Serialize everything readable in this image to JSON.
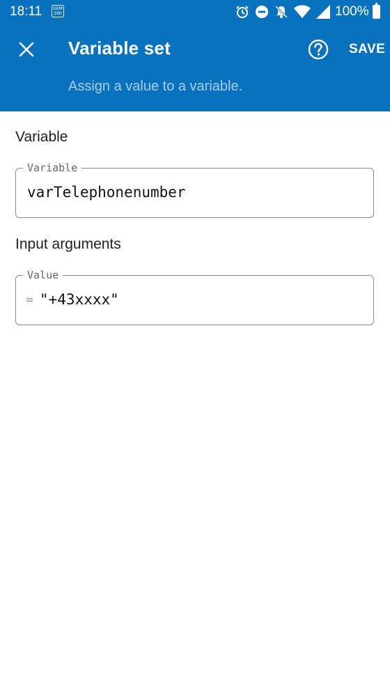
{
  "status_bar": {
    "time": "18:11",
    "sim_label": "GEM 260",
    "battery_percent": "100%"
  },
  "header": {
    "title": "Variable set",
    "subtitle": "Assign a value to a variable.",
    "save_label": "SAVE",
    "background_color": "#0872be",
    "icons": [
      "close-icon",
      "help-icon"
    ]
  },
  "variable_section": {
    "label": "Variable",
    "field_legend": "Variable",
    "field_value": "varTelephonenumber"
  },
  "input_section": {
    "label": "Input arguments",
    "field_legend": "Value",
    "prefix": "=",
    "field_value": "\"+43xxxx\""
  }
}
